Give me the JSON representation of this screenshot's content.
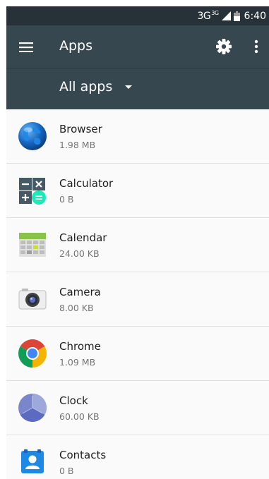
{
  "status_bar": {
    "network": "3G",
    "network_sup": "3G",
    "time": "6:40"
  },
  "toolbar": {
    "title": "Apps",
    "menu_icon": "hamburger-menu-icon",
    "settings_icon": "gear-icon",
    "overflow_icon": "more-vert-icon"
  },
  "filter": {
    "selected": "All apps"
  },
  "apps": [
    {
      "name": "Browser",
      "size": "1.98 MB",
      "icon": "browser-globe-icon"
    },
    {
      "name": "Calculator",
      "size": "0 B",
      "icon": "calculator-icon"
    },
    {
      "name": "Calendar",
      "size": "24.00 KB",
      "icon": "calendar-icon"
    },
    {
      "name": "Camera",
      "size": "8.00 KB",
      "icon": "camera-icon"
    },
    {
      "name": "Chrome",
      "size": "1.09 MB",
      "icon": "chrome-icon"
    },
    {
      "name": "Clock",
      "size": "60.00 KB",
      "icon": "clock-icon"
    },
    {
      "name": "Contacts",
      "size": "0 B",
      "icon": "contacts-icon"
    }
  ],
  "colors": {
    "status_bar": "#263238",
    "toolbar": "#37474f",
    "list_background": "#fafafa",
    "primary_text": "#212121",
    "secondary_text": "#757575"
  }
}
